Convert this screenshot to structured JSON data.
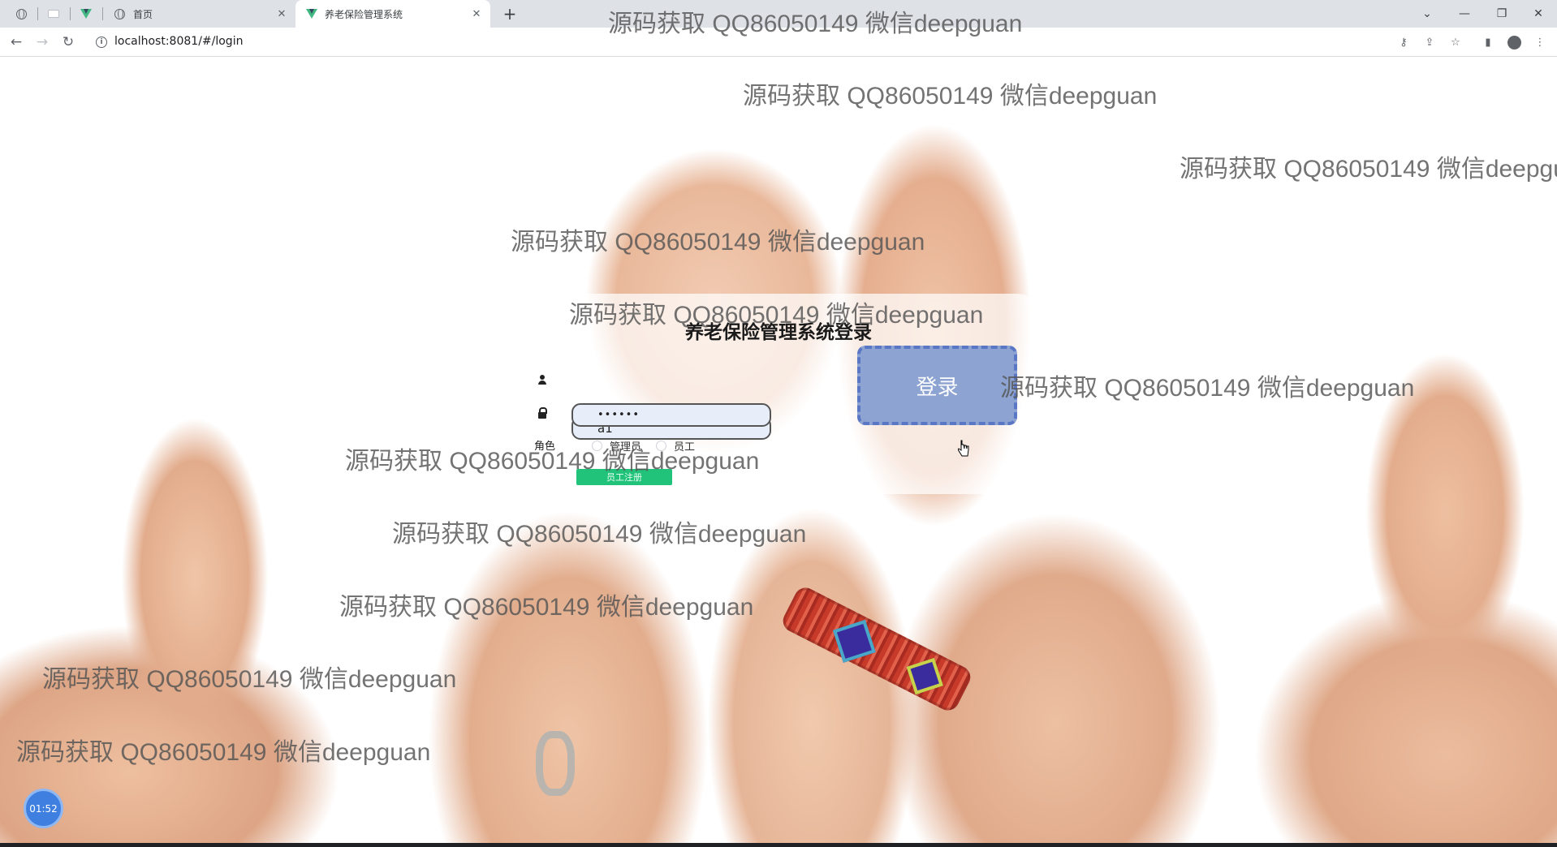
{
  "browser": {
    "tabs": [
      {
        "title": "",
        "pinned": true
      },
      {
        "title": "",
        "pinned": true
      },
      {
        "title": "",
        "pinned": true
      },
      {
        "title": "首页",
        "pinned": false
      },
      {
        "title": "养老保险管理系统",
        "pinned": false,
        "active": true
      }
    ],
    "url": "localhost:8081/#/login"
  },
  "login": {
    "title": "养老保险管理系统登录",
    "username_value": "a1",
    "password_mask": "••••••",
    "role_label": "角色",
    "roles": [
      "管理员",
      "员工"
    ],
    "login_button": "登录",
    "register_button": "员工注册"
  },
  "watermark": {
    "text": "源码获取 QQ86050149 微信deepguan"
  },
  "timer": {
    "value": "01:52"
  },
  "colors": {
    "login_button_bg": "#8da3d1",
    "register_button_bg": "#21c27a",
    "timer_bg": "#3e7fe0"
  }
}
